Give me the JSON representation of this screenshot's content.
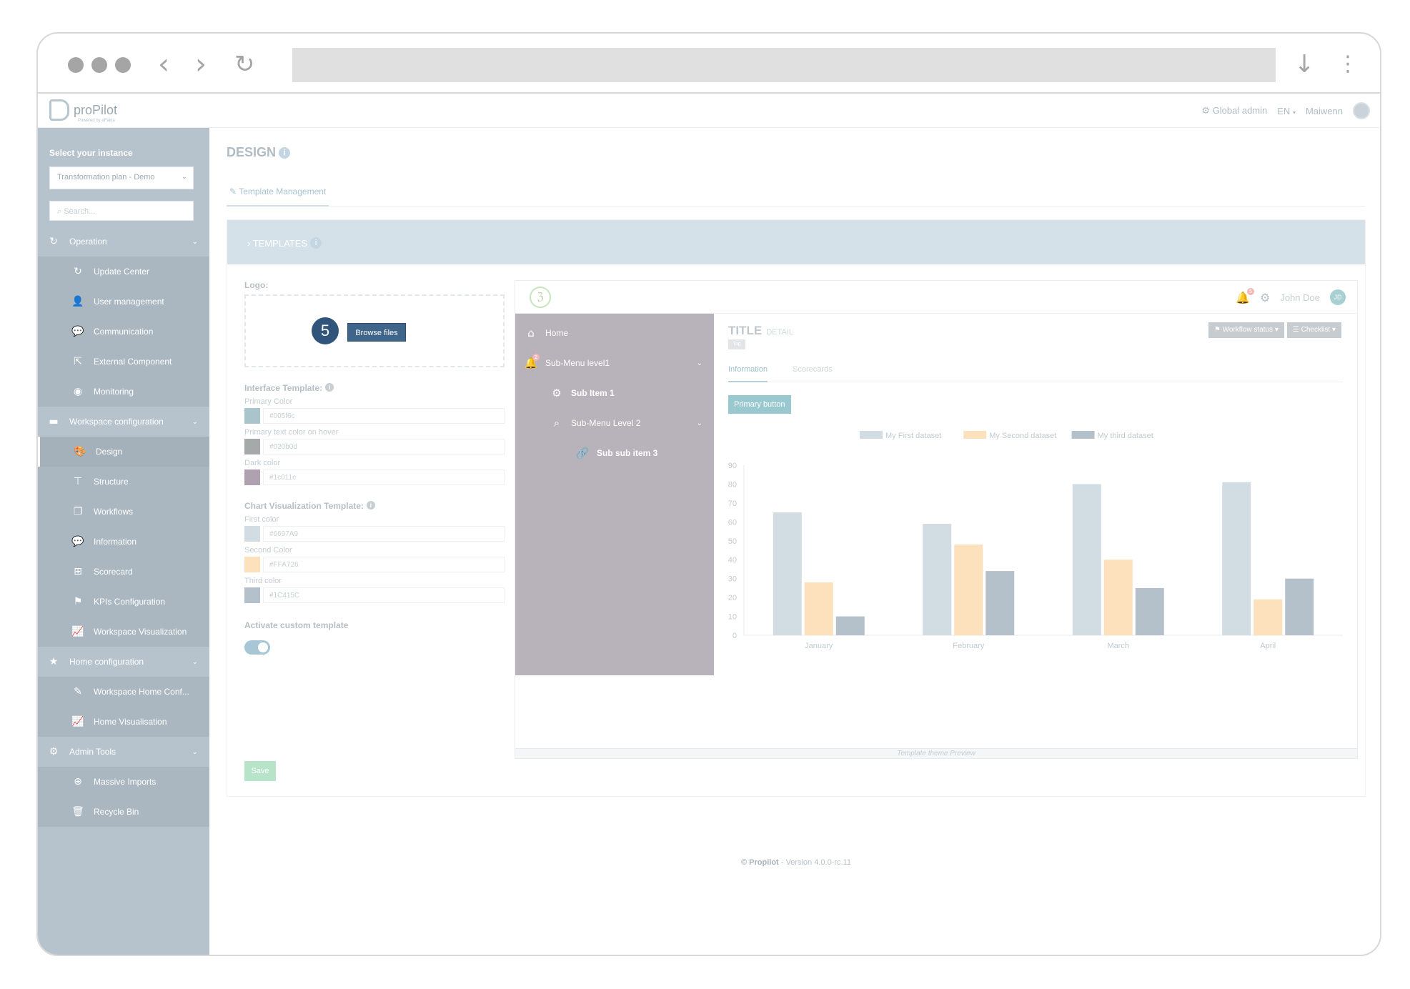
{
  "app": {
    "brand": "proPilot",
    "brand_sub": "Powered by eFakta",
    "header": {
      "role": "Global admin",
      "lang": "EN",
      "user": "Maiwenn"
    }
  },
  "sidebar": {
    "instance_label": "Select your instance",
    "instance_value": "Transformation plan - Demo",
    "search_placeholder": "Search...",
    "items": [
      {
        "label": "Operation",
        "icon": "refresh-icon",
        "glyph": "↻",
        "type": "group"
      },
      {
        "label": "Update Center",
        "icon": "refresh-icon",
        "glyph": "↻",
        "type": "sub"
      },
      {
        "label": "User management",
        "icon": "user-icon",
        "glyph": "👤",
        "type": "sub"
      },
      {
        "label": "Communication",
        "icon": "chat-icon",
        "glyph": "💬",
        "type": "sub"
      },
      {
        "label": "External Component",
        "icon": "external-link-icon",
        "glyph": "⇱",
        "type": "sub"
      },
      {
        "label": "Monitoring",
        "icon": "eye-icon",
        "glyph": "◉",
        "type": "sub"
      },
      {
        "label": "Workspace configuration",
        "icon": "folder-icon",
        "glyph": "▬",
        "type": "group"
      },
      {
        "label": "Design",
        "icon": "palette-icon",
        "glyph": "🎨",
        "type": "active"
      },
      {
        "label": "Structure",
        "icon": "sitemap-icon",
        "glyph": "⊤",
        "type": "sub"
      },
      {
        "label": "Workflows",
        "icon": "copy-icon",
        "glyph": "❐",
        "type": "sub"
      },
      {
        "label": "Information",
        "icon": "comment-icon",
        "glyph": "💬",
        "type": "sub"
      },
      {
        "label": "Scorecard",
        "icon": "table-icon",
        "glyph": "⊞",
        "type": "sub"
      },
      {
        "label": "KPIs Configuration",
        "icon": "flag-icon",
        "glyph": "⚑",
        "type": "sub"
      },
      {
        "label": "Workspace Visualization",
        "icon": "chart-line-icon",
        "glyph": "📈",
        "type": "sub"
      },
      {
        "label": "Home configuration",
        "icon": "star-icon",
        "glyph": "★",
        "type": "group"
      },
      {
        "label": "Workspace Home Conf...",
        "icon": "edit-icon",
        "glyph": "✎",
        "type": "sub"
      },
      {
        "label": "Home Visualisation",
        "icon": "chart-line-icon",
        "glyph": "📈",
        "type": "sub"
      },
      {
        "label": "Admin Tools",
        "icon": "gear-icon",
        "glyph": "⚙",
        "type": "group"
      },
      {
        "label": "Massive Imports",
        "icon": "download-icon",
        "glyph": "⊕",
        "type": "sub"
      },
      {
        "label": "Recycle Bin",
        "icon": "trash-icon",
        "glyph": "🗑",
        "type": "sub"
      }
    ]
  },
  "main": {
    "title": "DESIGN",
    "tab": "Template Management",
    "card_title": "TEMPLATES",
    "form": {
      "logo_label": "Logo:",
      "step_number": "5",
      "browse_label": "Browse files",
      "interface_label": "Interface Template:",
      "interface_colors": [
        {
          "label": "Primary Color",
          "value": "#005f6c",
          "swatch": "#a9c4cb"
        },
        {
          "label": "Primary text color on hover",
          "value": "#020b0d",
          "swatch": "#a6a9aa"
        },
        {
          "label": "Dark color",
          "value": "#1c011c",
          "swatch": "#b0a1b0"
        }
      ],
      "chart_label": "Chart Visualization Template:",
      "chart_colors": [
        {
          "label": "First color",
          "value": "#6697A9",
          "swatch": "#d1dde3"
        },
        {
          "label": "Second Color",
          "value": "#FFA726",
          "swatch": "#fde1bd"
        },
        {
          "label": "Third color",
          "value": "#1C415C",
          "swatch": "#b5c1ca"
        }
      ],
      "activate_label": "Activate custom template",
      "save_label": "Save"
    },
    "preview": {
      "logo_glyph": "ℨ",
      "notif_count": "5",
      "user": "John Doe",
      "user_initials": "JD",
      "menu": [
        {
          "label": "Home",
          "icon": "home-icon",
          "glyph": "⌂",
          "indent": 0,
          "chev": false,
          "badge": ""
        },
        {
          "label": "Sub-Menu level1",
          "icon": "bell-icon",
          "glyph": "🔔",
          "indent": 0,
          "chev": true,
          "badge": "2"
        },
        {
          "label": "Sub Item 1",
          "icon": "gear-icon",
          "glyph": "⚙",
          "indent": 1,
          "chev": false,
          "badge": ""
        },
        {
          "label": "Sub-Menu Level 2",
          "icon": "search-icon",
          "glyph": "⌕",
          "indent": 1,
          "chev": true,
          "badge": ""
        },
        {
          "label": "Sub sub item 3",
          "icon": "link-icon",
          "glyph": "🔗",
          "indent": 2,
          "chev": false,
          "badge": ""
        }
      ],
      "title": "TITLE",
      "detail": "DETAIL",
      "tag": "Tag",
      "workflow_label": "Workflow status",
      "checklist_label": "Checklist",
      "tabs": [
        "Information",
        "Scorecards"
      ],
      "primary_button": "Primary button",
      "caption": "Template theme Preview"
    }
  },
  "chart_data": {
    "type": "bar",
    "categories": [
      "January",
      "February",
      "March",
      "April"
    ],
    "series": [
      {
        "name": "My First dataset",
        "values": [
          65,
          59,
          80,
          81
        ],
        "color": "#d1dde3"
      },
      {
        "name": "My Second dataset",
        "values": [
          28,
          48,
          40,
          19
        ],
        "color": "#fde1bd"
      },
      {
        "name": "My third dataset",
        "values": [
          10,
          34,
          25,
          30
        ],
        "color": "#b5c1ca"
      }
    ],
    "ylim": [
      0,
      90
    ],
    "yticks": [
      0,
      10,
      20,
      30,
      40,
      50,
      60,
      70,
      80,
      90
    ],
    "legend": "top",
    "grid": false
  },
  "footer": {
    "brand": "© Propilot",
    "version": " - Version 4.0.0-rc.11"
  }
}
